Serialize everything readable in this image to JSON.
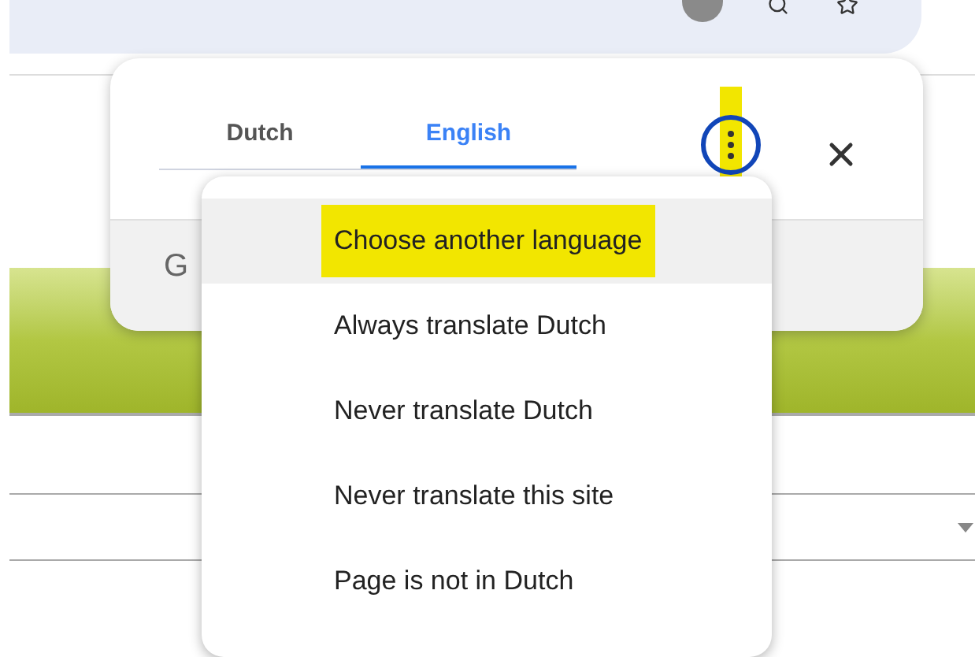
{
  "translate_popup": {
    "tabs": [
      {
        "label": "Dutch",
        "selected": false
      },
      {
        "label": "English",
        "selected": true
      }
    ],
    "footer_text": "G"
  },
  "menu": {
    "items": [
      {
        "label": "Choose another language",
        "selected": true,
        "marked": true
      },
      {
        "label": "Always translate Dutch",
        "selected": false,
        "marked": false
      },
      {
        "label": "Never translate Dutch",
        "selected": false,
        "marked": false
      },
      {
        "label": "Never translate this site",
        "selected": false,
        "marked": false
      },
      {
        "label": "Page is not in Dutch",
        "selected": false,
        "marked": false
      }
    ]
  }
}
